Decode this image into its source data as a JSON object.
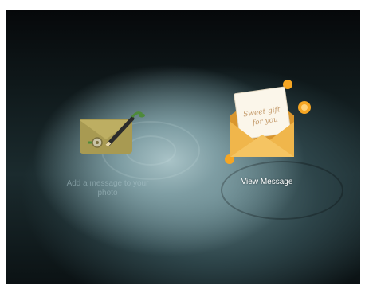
{
  "apps": [
    {
      "label": "Add a message to your photo",
      "icon": "envelope-pen-icon",
      "state": "dimmed"
    },
    {
      "label": "View Message",
      "icon": "open-envelope-letter-icon",
      "state": "selected"
    }
  ],
  "letter_text_line1": "Sweet gift",
  "letter_text_line2": "for you",
  "colors": {
    "accent_orange": "#f6a623",
    "envelope_gold": "#e9b24a",
    "envelope_dim": "#a89a52",
    "pen_green": "#4e8a3a"
  }
}
